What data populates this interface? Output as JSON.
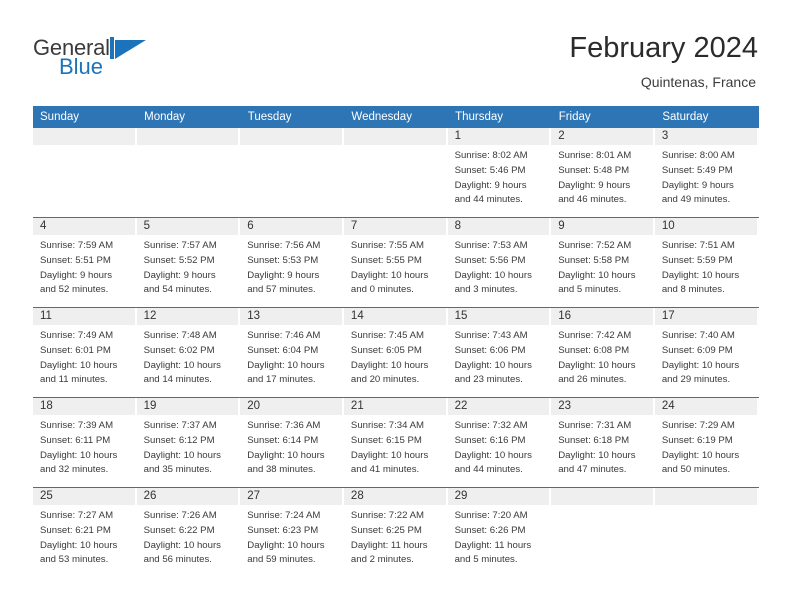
{
  "brand": {
    "name_top": "General",
    "name_bottom": "Blue",
    "mark": "triangle-logo-icon",
    "accent_color": "#1b74bb"
  },
  "header": {
    "title": "February 2024",
    "subtitle": "Quintenas, France"
  },
  "calendar": {
    "header_color": "#2e75b6",
    "day_band_color": "#efefef",
    "weekdays": [
      "Sunday",
      "Monday",
      "Tuesday",
      "Wednesday",
      "Thursday",
      "Friday",
      "Saturday"
    ],
    "weeks": [
      [
        {
          "empty": true
        },
        {
          "empty": true
        },
        {
          "empty": true
        },
        {
          "empty": true
        },
        {
          "day": "1",
          "sunrise": "Sunrise: 8:02 AM",
          "sunset": "Sunset: 5:46 PM",
          "daylight_line1": "Daylight: 9 hours",
          "daylight_line2": "and 44 minutes."
        },
        {
          "day": "2",
          "sunrise": "Sunrise: 8:01 AM",
          "sunset": "Sunset: 5:48 PM",
          "daylight_line1": "Daylight: 9 hours",
          "daylight_line2": "and 46 minutes."
        },
        {
          "day": "3",
          "sunrise": "Sunrise: 8:00 AM",
          "sunset": "Sunset: 5:49 PM",
          "daylight_line1": "Daylight: 9 hours",
          "daylight_line2": "and 49 minutes."
        }
      ],
      [
        {
          "day": "4",
          "sunrise": "Sunrise: 7:59 AM",
          "sunset": "Sunset: 5:51 PM",
          "daylight_line1": "Daylight: 9 hours",
          "daylight_line2": "and 52 minutes."
        },
        {
          "day": "5",
          "sunrise": "Sunrise: 7:57 AM",
          "sunset": "Sunset: 5:52 PM",
          "daylight_line1": "Daylight: 9 hours",
          "daylight_line2": "and 54 minutes."
        },
        {
          "day": "6",
          "sunrise": "Sunrise: 7:56 AM",
          "sunset": "Sunset: 5:53 PM",
          "daylight_line1": "Daylight: 9 hours",
          "daylight_line2": "and 57 minutes."
        },
        {
          "day": "7",
          "sunrise": "Sunrise: 7:55 AM",
          "sunset": "Sunset: 5:55 PM",
          "daylight_line1": "Daylight: 10 hours",
          "daylight_line2": "and 0 minutes."
        },
        {
          "day": "8",
          "sunrise": "Sunrise: 7:53 AM",
          "sunset": "Sunset: 5:56 PM",
          "daylight_line1": "Daylight: 10 hours",
          "daylight_line2": "and 3 minutes."
        },
        {
          "day": "9",
          "sunrise": "Sunrise: 7:52 AM",
          "sunset": "Sunset: 5:58 PM",
          "daylight_line1": "Daylight: 10 hours",
          "daylight_line2": "and 5 minutes."
        },
        {
          "day": "10",
          "sunrise": "Sunrise: 7:51 AM",
          "sunset": "Sunset: 5:59 PM",
          "daylight_line1": "Daylight: 10 hours",
          "daylight_line2": "and 8 minutes."
        }
      ],
      [
        {
          "day": "11",
          "sunrise": "Sunrise: 7:49 AM",
          "sunset": "Sunset: 6:01 PM",
          "daylight_line1": "Daylight: 10 hours",
          "daylight_line2": "and 11 minutes."
        },
        {
          "day": "12",
          "sunrise": "Sunrise: 7:48 AM",
          "sunset": "Sunset: 6:02 PM",
          "daylight_line1": "Daylight: 10 hours",
          "daylight_line2": "and 14 minutes."
        },
        {
          "day": "13",
          "sunrise": "Sunrise: 7:46 AM",
          "sunset": "Sunset: 6:04 PM",
          "daylight_line1": "Daylight: 10 hours",
          "daylight_line2": "and 17 minutes."
        },
        {
          "day": "14",
          "sunrise": "Sunrise: 7:45 AM",
          "sunset": "Sunset: 6:05 PM",
          "daylight_line1": "Daylight: 10 hours",
          "daylight_line2": "and 20 minutes."
        },
        {
          "day": "15",
          "sunrise": "Sunrise: 7:43 AM",
          "sunset": "Sunset: 6:06 PM",
          "daylight_line1": "Daylight: 10 hours",
          "daylight_line2": "and 23 minutes."
        },
        {
          "day": "16",
          "sunrise": "Sunrise: 7:42 AM",
          "sunset": "Sunset: 6:08 PM",
          "daylight_line1": "Daylight: 10 hours",
          "daylight_line2": "and 26 minutes."
        },
        {
          "day": "17",
          "sunrise": "Sunrise: 7:40 AM",
          "sunset": "Sunset: 6:09 PM",
          "daylight_line1": "Daylight: 10 hours",
          "daylight_line2": "and 29 minutes."
        }
      ],
      [
        {
          "day": "18",
          "sunrise": "Sunrise: 7:39 AM",
          "sunset": "Sunset: 6:11 PM",
          "daylight_line1": "Daylight: 10 hours",
          "daylight_line2": "and 32 minutes."
        },
        {
          "day": "19",
          "sunrise": "Sunrise: 7:37 AM",
          "sunset": "Sunset: 6:12 PM",
          "daylight_line1": "Daylight: 10 hours",
          "daylight_line2": "and 35 minutes."
        },
        {
          "day": "20",
          "sunrise": "Sunrise: 7:36 AM",
          "sunset": "Sunset: 6:14 PM",
          "daylight_line1": "Daylight: 10 hours",
          "daylight_line2": "and 38 minutes."
        },
        {
          "day": "21",
          "sunrise": "Sunrise: 7:34 AM",
          "sunset": "Sunset: 6:15 PM",
          "daylight_line1": "Daylight: 10 hours",
          "daylight_line2": "and 41 minutes."
        },
        {
          "day": "22",
          "sunrise": "Sunrise: 7:32 AM",
          "sunset": "Sunset: 6:16 PM",
          "daylight_line1": "Daylight: 10 hours",
          "daylight_line2": "and 44 minutes."
        },
        {
          "day": "23",
          "sunrise": "Sunrise: 7:31 AM",
          "sunset": "Sunset: 6:18 PM",
          "daylight_line1": "Daylight: 10 hours",
          "daylight_line2": "and 47 minutes."
        },
        {
          "day": "24",
          "sunrise": "Sunrise: 7:29 AM",
          "sunset": "Sunset: 6:19 PM",
          "daylight_line1": "Daylight: 10 hours",
          "daylight_line2": "and 50 minutes."
        }
      ],
      [
        {
          "day": "25",
          "sunrise": "Sunrise: 7:27 AM",
          "sunset": "Sunset: 6:21 PM",
          "daylight_line1": "Daylight: 10 hours",
          "daylight_line2": "and 53 minutes."
        },
        {
          "day": "26",
          "sunrise": "Sunrise: 7:26 AM",
          "sunset": "Sunset: 6:22 PM",
          "daylight_line1": "Daylight: 10 hours",
          "daylight_line2": "and 56 minutes."
        },
        {
          "day": "27",
          "sunrise": "Sunrise: 7:24 AM",
          "sunset": "Sunset: 6:23 PM",
          "daylight_line1": "Daylight: 10 hours",
          "daylight_line2": "and 59 minutes."
        },
        {
          "day": "28",
          "sunrise": "Sunrise: 7:22 AM",
          "sunset": "Sunset: 6:25 PM",
          "daylight_line1": "Daylight: 11 hours",
          "daylight_line2": "and 2 minutes."
        },
        {
          "day": "29",
          "sunrise": "Sunrise: 7:20 AM",
          "sunset": "Sunset: 6:26 PM",
          "daylight_line1": "Daylight: 11 hours",
          "daylight_line2": "and 5 minutes."
        },
        {
          "empty": true
        },
        {
          "empty": true
        }
      ]
    ]
  }
}
